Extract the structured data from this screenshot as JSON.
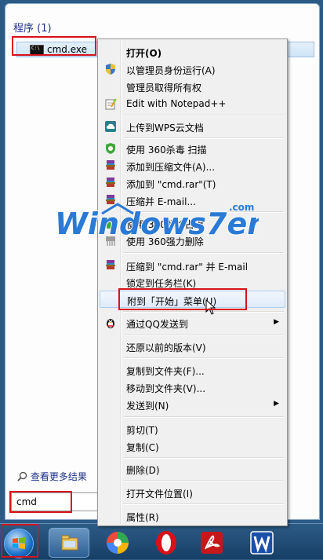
{
  "start_menu": {
    "section_title": "程序 (1)",
    "program_item": "cmd.exe",
    "see_more": "查看更多结果",
    "search_value": "cmd"
  },
  "context_menu": {
    "items": [
      {
        "label": "打开(O)",
        "icon": "none"
      },
      {
        "label": "以管理员身份运行(A)",
        "icon": "uac-shield-icon"
      },
      {
        "label": "管理员取得所有权",
        "icon": "none"
      },
      {
        "label": "Edit with Notepad++",
        "icon": "notepadpp-icon"
      },
      {
        "label": "上传到WPS云文档",
        "icon": "wps-cloud-icon"
      },
      {
        "label": "使用 360杀毒 扫描",
        "icon": "360-shield-icon"
      },
      {
        "label": "添加到压缩文件(A)...",
        "icon": "winrar-icon"
      },
      {
        "label": "添加到 \"cmd.rar\"(T)",
        "icon": "winrar-icon"
      },
      {
        "label": "压缩并 E-mail...",
        "icon": "winrar-icon"
      },
      {
        "label": "使用 360解除占用",
        "icon": "360-unlock-icon"
      },
      {
        "label": "使用 360强力删除",
        "icon": "360-shred-icon"
      },
      {
        "label": "压缩到 \"cmd.rar\" 并 E-mail",
        "icon": "winrar-icon"
      },
      {
        "label": "锁定到任务栏(K)",
        "icon": "none"
      },
      {
        "label": "附到「开始」菜单(U)",
        "icon": "none"
      },
      {
        "label": "通过QQ发送到",
        "icon": "qq-penguin-icon"
      },
      {
        "label": "还原以前的版本(V)",
        "icon": "none"
      },
      {
        "label": "复制到文件夹(F)...",
        "icon": "none"
      },
      {
        "label": "移动到文件夹(V)...",
        "icon": "none"
      },
      {
        "label": "发送到(N)",
        "icon": "none"
      },
      {
        "label": "剪切(T)",
        "icon": "none"
      },
      {
        "label": "复制(C)",
        "icon": "none"
      },
      {
        "label": "删除(D)",
        "icon": "none"
      },
      {
        "label": "打开文件位置(I)",
        "icon": "none"
      },
      {
        "label": "属性(R)",
        "icon": "none"
      }
    ]
  },
  "watermark": {
    "text": "Windows7en",
    "domain": ".com"
  },
  "taskbar": {
    "buttons": [
      "start-orb",
      "explorer-icon",
      "360-browser-icon",
      "opera-icon",
      "acrobat-icon",
      "wps-writer-icon"
    ]
  },
  "colors": {
    "highlight_box": "#d7121a",
    "accent": "#1e3287",
    "taskbar": "#2c5b86"
  }
}
